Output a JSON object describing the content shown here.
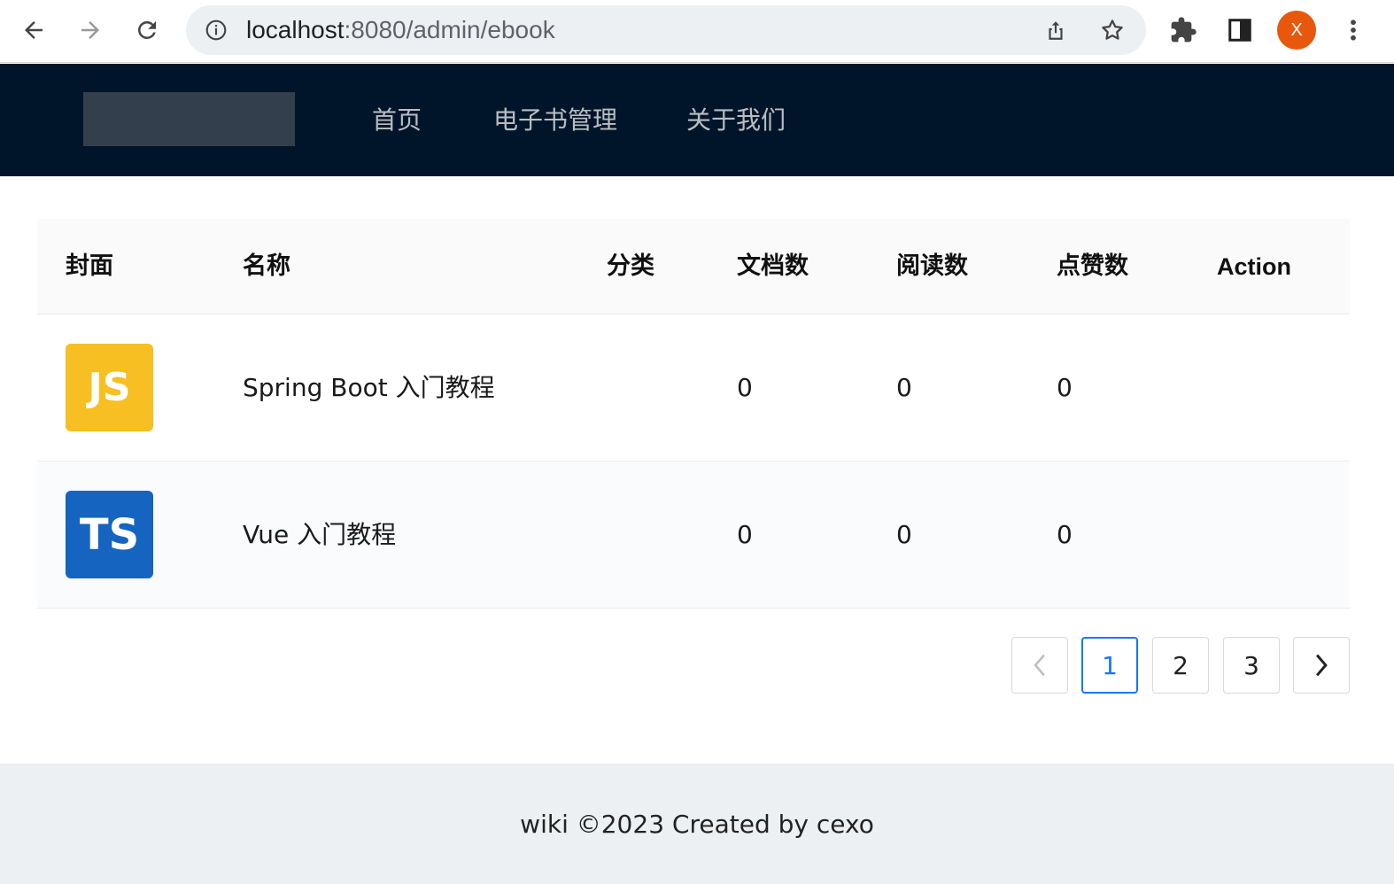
{
  "browser": {
    "url_host": "localhost",
    "url_rest": ":8080/admin/ebook",
    "avatar_letter": "X"
  },
  "header": {
    "menu": [
      {
        "label": "首页"
      },
      {
        "label": "电子书管理"
      },
      {
        "label": "关于我们"
      }
    ]
  },
  "table": {
    "columns": [
      "封面",
      "名称",
      "分类",
      "文档数",
      "阅读数",
      "点赞数",
      "Action"
    ],
    "rows": [
      {
        "cover_text": "JS",
        "cover_color": "#f7bf22",
        "name": "Spring Boot 入门教程",
        "category": "",
        "doc_count": "0",
        "view_count": "0",
        "vote_count": "0"
      },
      {
        "cover_text": "TS",
        "cover_color": "#1565c0",
        "name": "Vue 入门教程",
        "category": "",
        "doc_count": "0",
        "view_count": "0",
        "vote_count": "0"
      }
    ]
  },
  "pagination": {
    "prev": "<",
    "pages": [
      "1",
      "2",
      "3"
    ],
    "current": "1",
    "next": ">"
  },
  "footer": {
    "text": "wiki ©2023 Created by cexo"
  },
  "colors": {
    "header_bg": "#001529",
    "accent": "#1677ff",
    "footer_bg": "#edf0f3"
  }
}
